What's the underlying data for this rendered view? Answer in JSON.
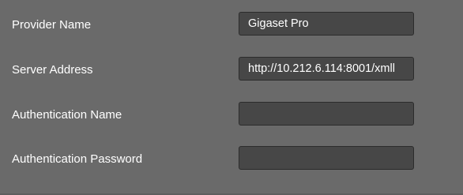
{
  "form": {
    "fields": [
      {
        "label": "Provider Name",
        "value": "Gigaset Pro",
        "placeholder": ""
      },
      {
        "label": "Server Address",
        "value": "http://10.212.6.114:8001/xmll",
        "placeholder": ""
      },
      {
        "label": "Authentication Name",
        "value": "",
        "placeholder": ""
      },
      {
        "label": "Authentication Password",
        "value": "",
        "placeholder": ""
      }
    ]
  },
  "colors": {
    "panel_background": "#6a6a6a",
    "input_background": "#474747",
    "input_border": "#2c2c2c",
    "text": "#ffffff"
  }
}
